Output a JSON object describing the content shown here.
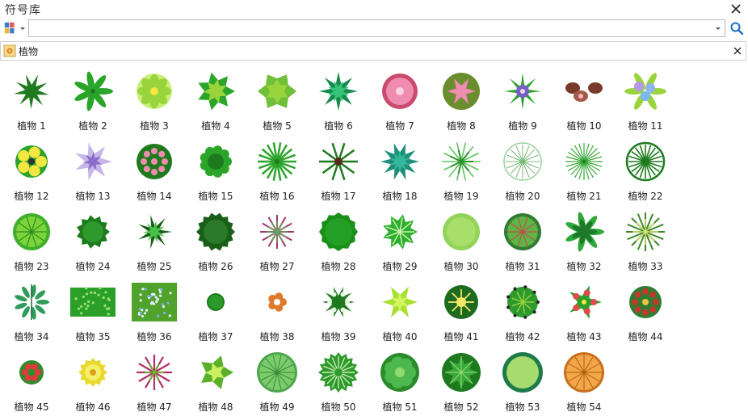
{
  "window": {
    "title": "符号库",
    "close_icon": "close-icon"
  },
  "search": {
    "value": "",
    "placeholder": "",
    "library_icon": "library-menu-icon",
    "search_icon": "search-icon"
  },
  "category": {
    "label": "植物",
    "icon": "plant-category-icon",
    "close_icon": "close-icon"
  },
  "colors": {
    "dark_green": "#1d7a1d",
    "green": "#2aa52a",
    "light_green": "#9ad43c",
    "pink": "#f08cb0",
    "purple": "#7b5cc4",
    "orange": "#f0a040",
    "yellow": "#f5e640"
  },
  "symbols": [
    {
      "label": "植物 1"
    },
    {
      "label": "植物 2"
    },
    {
      "label": "植物 3"
    },
    {
      "label": "植物 4"
    },
    {
      "label": "植物 5"
    },
    {
      "label": "植物 6"
    },
    {
      "label": "植物 7"
    },
    {
      "label": "植物 8"
    },
    {
      "label": "植物 9"
    },
    {
      "label": "植物 10"
    },
    {
      "label": "植物 11"
    },
    {
      "label": "植物 12"
    },
    {
      "label": "植物 13"
    },
    {
      "label": "植物 14"
    },
    {
      "label": "植物 15"
    },
    {
      "label": "植物 16"
    },
    {
      "label": "植物 17"
    },
    {
      "label": "植物 18"
    },
    {
      "label": "植物 19"
    },
    {
      "label": "植物 20"
    },
    {
      "label": "植物 21"
    },
    {
      "label": "植物 22"
    },
    {
      "label": "植物 23"
    },
    {
      "label": "植物 24"
    },
    {
      "label": "植物 25"
    },
    {
      "label": "植物 26"
    },
    {
      "label": "植物 27"
    },
    {
      "label": "植物 28"
    },
    {
      "label": "植物 29"
    },
    {
      "label": "植物 30"
    },
    {
      "label": "植物 31"
    },
    {
      "label": "植物 32"
    },
    {
      "label": "植物 33"
    },
    {
      "label": "植物 34"
    },
    {
      "label": "植物 35"
    },
    {
      "label": "植物 36"
    },
    {
      "label": "植物 37"
    },
    {
      "label": "植物 38"
    },
    {
      "label": "植物 39"
    },
    {
      "label": "植物 40"
    },
    {
      "label": "植物 41"
    },
    {
      "label": "植物 42"
    },
    {
      "label": "植物 43"
    },
    {
      "label": "植物 44"
    },
    {
      "label": "植物 45"
    },
    {
      "label": "植物 46"
    },
    {
      "label": "植物 47"
    },
    {
      "label": "植物 48"
    },
    {
      "label": "植物 49"
    },
    {
      "label": "植物 50"
    },
    {
      "label": "植物 51"
    },
    {
      "label": "植物 52"
    },
    {
      "label": "植物 53"
    },
    {
      "label": "植物 54"
    }
  ]
}
